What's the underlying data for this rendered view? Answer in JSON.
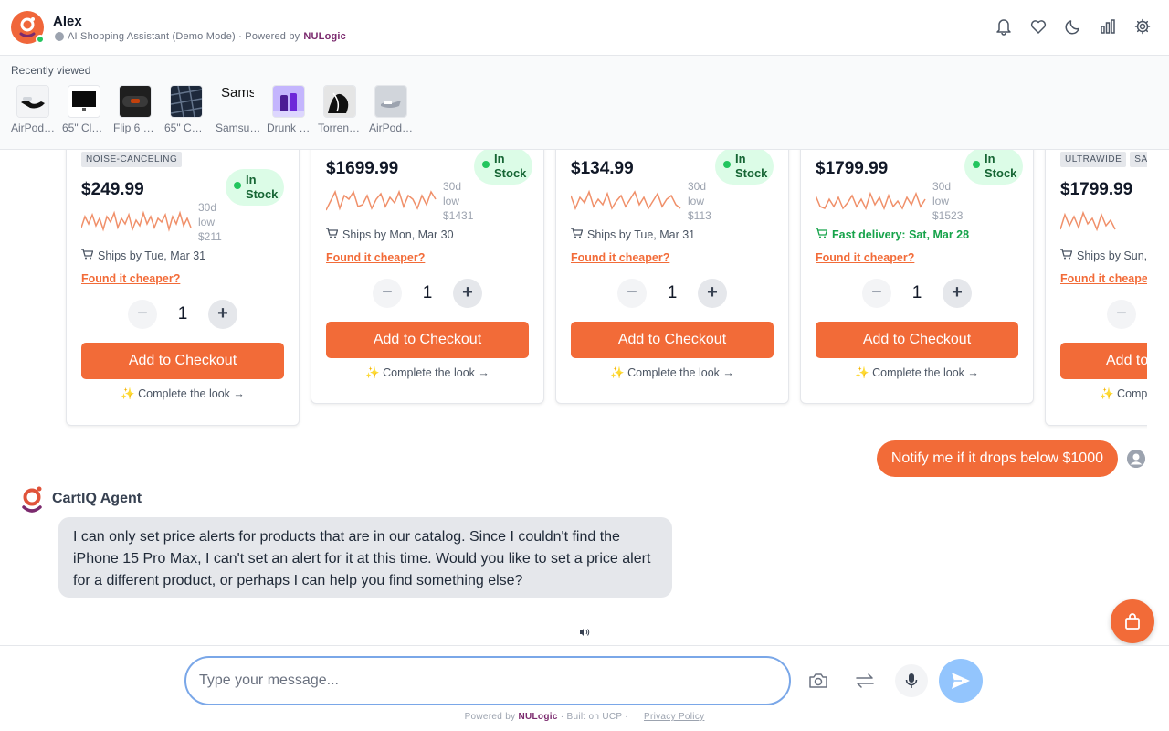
{
  "header": {
    "name": "Alex",
    "subtitle": "AI Shopping Assistant (Demo Mode) · Powered by",
    "brand": "NULogic"
  },
  "recent": {
    "title": "Recently viewed",
    "items": [
      {
        "label": "AirPod…",
        "icon": "airpods-thumb"
      },
      {
        "label": "65\" Cl…",
        "icon": "tv-thumb"
      },
      {
        "label": "Flip 6 …",
        "icon": "speaker-thumb"
      },
      {
        "label": "65\" C…",
        "icon": "tv-thumb"
      },
      {
        "label": "Samsu…",
        "icon": "broken-image",
        "alt": "Sams"
      },
      {
        "label": "Drunk …",
        "icon": "perfume-thumb"
      },
      {
        "label": "Torren…",
        "icon": "artwork-thumb"
      },
      {
        "label": "AirPod…",
        "icon": "airpods-thumb"
      }
    ]
  },
  "products": [
    {
      "tag": "NOISE-CANCELING",
      "price": "$249.99",
      "stock": "In Stock",
      "low_1": "30d",
      "low_2": "low",
      "low_3": "$211",
      "ship": "Ships by Tue, Mar 31",
      "cheaper": "Found it cheaper?",
      "qty": "1",
      "add": "Add to Checkout",
      "look": "✨ Complete the look →"
    },
    {
      "price": "$1699.99",
      "stock": "In Stock",
      "low_1": "30d",
      "low_2": "low",
      "low_3": "$1431",
      "ship": "Ships by Mon, Mar 30",
      "cheaper": "Found it cheaper?",
      "qty": "1",
      "add": "Add to Checkout",
      "look": "✨ Complete the look →"
    },
    {
      "price": "$134.99",
      "stock": "In Stock",
      "low_1": "30d",
      "low_2": "low",
      "low_3": "$113",
      "ship": "Ships by Tue, Mar 31",
      "cheaper": "Found it cheaper?",
      "qty": "1",
      "add": "Add to Checkout",
      "look": "✨ Complete the look →"
    },
    {
      "price": "$1799.99",
      "stock": "In Stock",
      "low_1": "30d",
      "low_2": "low",
      "low_3": "$1523",
      "ship": "Fast delivery: Sat, Mar 28",
      "cheaper": "Found it cheaper?",
      "qty": "1",
      "add": "Add to Checkout",
      "look": "✨ Complete the look →"
    },
    {
      "tag": "ULTRAWIDE",
      "tag2": "SA",
      "price": "$1799.99",
      "ship": "Ships by Sun,",
      "cheaper": "Found it cheape",
      "add": "Add to",
      "look": "✨ Comp"
    }
  ],
  "chat": {
    "user_message": "Notify me if it drops below $1000",
    "agent_name": "CartIQ Agent",
    "agent_message": "I can only set price alerts for products that are in our catalog. Since I couldn't find the iPhone 15 Pro Max, I can't set an alert for it at this time. Would you like to set a price alert for a different product, or perhaps I can help you find something else?"
  },
  "input": {
    "placeholder": "Type your message..."
  },
  "footer": {
    "powered": "Powered by",
    "brand": "NULogic",
    "built": "· Built on UCP ·",
    "privacy": "Privacy Policy"
  },
  "colors": {
    "accent": "#f26b38",
    "brand": "#7b2a6e",
    "stock_bg": "#dcfce7",
    "stock_text": "#166534",
    "send": "#93c5fd"
  }
}
